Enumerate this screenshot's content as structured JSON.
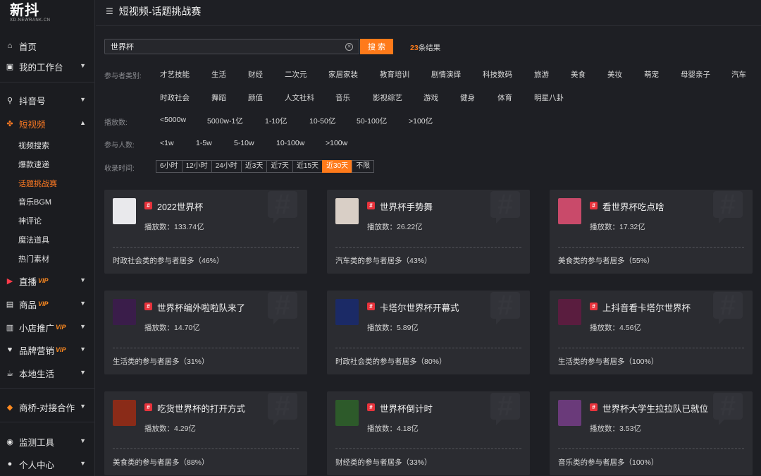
{
  "logo": {
    "main": "新抖",
    "sub": "XD.NEWRANK.CN"
  },
  "sidebar": {
    "items": [
      {
        "label": "首页",
        "icon": "home-icon"
      },
      {
        "label": "我的工作台",
        "icon": "workbench-icon"
      },
      {
        "label": "抖音号",
        "icon": "search-icon"
      },
      {
        "label": "短视频",
        "icon": "clover-icon"
      },
      {
        "label": "直播",
        "icon": "live-icon",
        "vip": "VIP"
      },
      {
        "label": "商品",
        "icon": "goods-icon",
        "vip": "VIP"
      },
      {
        "label": "小店推广",
        "icon": "shop-icon",
        "vip": "VIP"
      },
      {
        "label": "品牌营销",
        "icon": "brand-icon",
        "vip": "VIP"
      },
      {
        "label": "本地生活",
        "icon": "local-icon"
      },
      {
        "label": "商桥-对接合作",
        "icon": "bridge-icon"
      },
      {
        "label": "监测工具",
        "icon": "monitor-icon"
      },
      {
        "label": "个人中心",
        "icon": "user-icon"
      }
    ],
    "sub_items": [
      "视频搜索",
      "爆款速递",
      "话题挑战赛",
      "音乐BGM",
      "神评论",
      "魔法道具",
      "热门素材"
    ]
  },
  "header": {
    "title": "短视频-话题挑战赛"
  },
  "search": {
    "value": "世界杯",
    "button": "搜 索",
    "result_count": "23",
    "result_suffix": "条结果"
  },
  "filters": {
    "category_label": "参与者类别:",
    "categories_row1": [
      "才艺技能",
      "生活",
      "财经",
      "二次元",
      "家居家装",
      "教育培训",
      "剧情演绎",
      "科技数码",
      "旅游",
      "美食",
      "美妆",
      "萌宠",
      "母婴亲子",
      "汽车"
    ],
    "categories_row2": [
      "时政社会",
      "舞蹈",
      "颜值",
      "人文社科",
      "音乐",
      "影视综艺",
      "游戏",
      "健身",
      "体育",
      "明星八卦"
    ],
    "plays_label": "播放数:",
    "plays_options": [
      "<5000w",
      "5000w-1亿",
      "1-10亿",
      "10-50亿",
      "50-100亿",
      ">100亿"
    ],
    "participants_label": "参与人数:",
    "participants_options": [
      "<1w",
      "1-5w",
      "5-10w",
      "10-100w",
      ">100w"
    ],
    "time_label": "收录时间:",
    "time_options": [
      "6小时",
      "12小时",
      "24小时",
      "近3天",
      "近7天",
      "近15天",
      "近30天",
      "不限"
    ],
    "time_active": "近30天"
  },
  "cards": [
    {
      "title": "2022世界杯",
      "plays": "播放数：133.74亿",
      "category": "时政社会类的参与者居多（46%）",
      "thumb_color": "#e9e9ec"
    },
    {
      "title": "世界杯手势舞",
      "plays": "播放数：26.22亿",
      "category": "汽车类的参与者居多（43%）",
      "thumb_color": "#d9cfc6"
    },
    {
      "title": "看世界杯吃点啥",
      "plays": "播放数：17.32亿",
      "category": "美食类的参与者居多（55%）",
      "thumb_color": "#c94a6a"
    },
    {
      "title": "世界杯编外啦啦队来了",
      "plays": "播放数：14.70亿",
      "category": "生活类的参与者居多（31%）",
      "thumb_color": "#3a1d4a"
    },
    {
      "title": "卡塔尔世界杯开幕式",
      "plays": "播放数：5.89亿",
      "category": "时政社会类的参与者居多（80%）",
      "thumb_color": "#1b2a66"
    },
    {
      "title": "上抖音看卡塔尔世界杯",
      "plays": "播放数：4.56亿",
      "category": "生活类的参与者居多（100%）",
      "thumb_color": "#5a1d3f"
    },
    {
      "title": "吃货世界杯的打开方式",
      "plays": "播放数：4.29亿",
      "category": "美食类的参与者居多（88%）",
      "thumb_color": "#8a2b18"
    },
    {
      "title": "世界杯倒计时",
      "plays": "播放数：4.18亿",
      "category": "财经类的参与者居多（33%）",
      "thumb_color": "#2d5a2a"
    },
    {
      "title": "世界杯大学生拉拉队已就位",
      "plays": "播放数：3.53亿",
      "category": "音乐类的参与者居多（100%）",
      "thumb_color": "#6a3a7a"
    }
  ],
  "colors": {
    "accent": "#ff7a1a",
    "hash_badge": "#e8333c",
    "background": "#1e1f24",
    "card": "#2b2c31"
  }
}
